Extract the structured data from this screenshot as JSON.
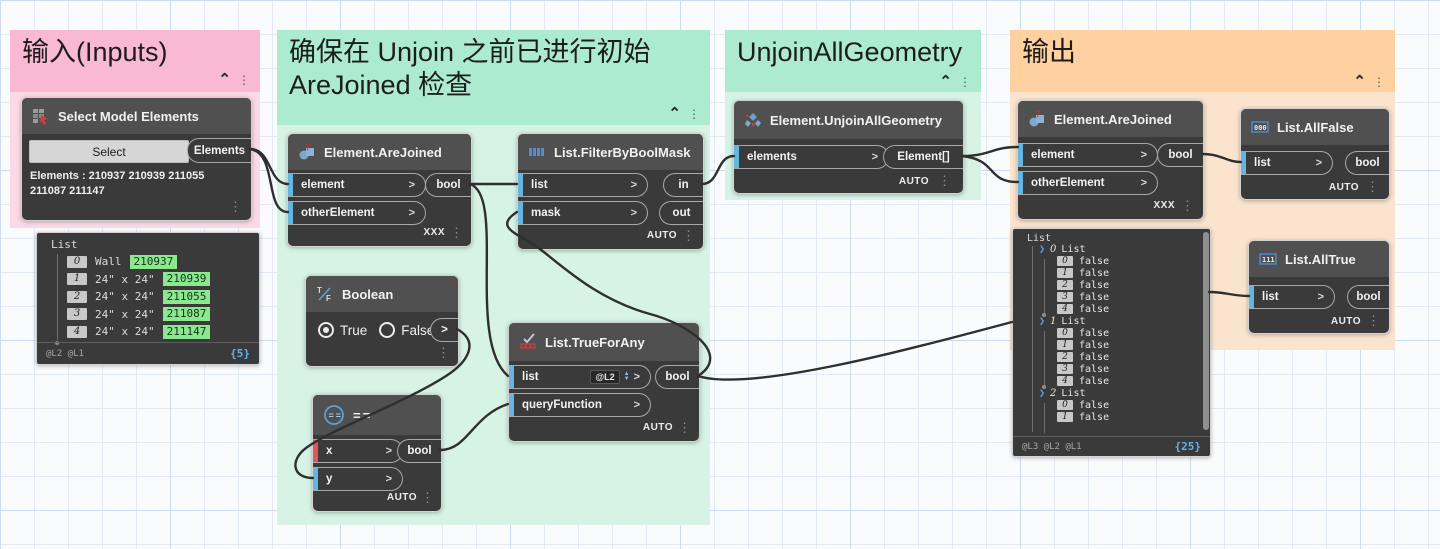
{
  "groups": {
    "inputs": {
      "title": "输入(Inputs)"
    },
    "check": {
      "title": "确保在 Unjoin 之前已进行初始 AreJoined 检查"
    },
    "unjoin": {
      "title": "UnjoinAllGeometry"
    },
    "outputs": {
      "title": "输出"
    }
  },
  "nodes": {
    "select_model_elements": {
      "title": "Select Model Elements",
      "button": "Select",
      "output": "Elements",
      "value_line1": "Elements : 210937 210939 211055",
      "value_line2": "211087 211147"
    },
    "watch_left": {
      "header": "List",
      "rows": [
        {
          "i": "0",
          "label": "Wall",
          "id": "210937"
        },
        {
          "i": "1",
          "label": "24\" x 24\"",
          "id": "210939"
        },
        {
          "i": "2",
          "label": "24\" x 24\"",
          "id": "211055"
        },
        {
          "i": "3",
          "label": "24\" x 24\"",
          "id": "211087"
        },
        {
          "i": "4",
          "label": "24\" x 24\"",
          "id": "211147"
        }
      ],
      "lacing": "@L2 @L1",
      "count": "{5}"
    },
    "are_joined_1": {
      "title": "Element.AreJoined",
      "port_element": "element",
      "port_other": "otherElement",
      "port_bool": "bool",
      "lacing": "XXX"
    },
    "filter": {
      "title": "List.FilterByBoolMask",
      "port_list": "list",
      "port_mask": "mask",
      "port_in": "in",
      "port_out": "out",
      "lacing": "AUTO"
    },
    "boolean": {
      "title": "Boolean",
      "opt_true": "True",
      "opt_false": "False",
      "selected": "True",
      "port_out": ">"
    },
    "equals": {
      "title": "==",
      "port_x": "x",
      "port_y": "y",
      "port_bool": "bool",
      "lacing": "AUTO",
      "x_connected": false,
      "y_connected": true
    },
    "true_for_any": {
      "title": "List.TrueForAny",
      "port_list": "list",
      "level_badge": "@L2",
      "port_query": "queryFunction",
      "port_bool": "bool",
      "lacing": "AUTO"
    },
    "unjoin_all": {
      "title": "Element.UnjoinAllGeometry",
      "port_elements": "elements",
      "port_out": "Element[]",
      "lacing": "AUTO"
    },
    "are_joined_2": {
      "title": "Element.AreJoined",
      "port_element": "element",
      "port_other": "otherElement",
      "port_bool": "bool",
      "lacing": "XXX"
    },
    "all_false": {
      "title": "List.AllFalse",
      "icon_text": "000",
      "port_list": "list",
      "port_bool": "bool",
      "lacing": "AUTO"
    },
    "all_true": {
      "title": "List.AllTrue",
      "icon_text": "111",
      "port_list": "list",
      "port_bool": "bool",
      "lacing": "AUTO"
    },
    "watch_big": {
      "header": "List",
      "sublists": [
        {
          "i": "0",
          "label": "List",
          "items": [
            "false",
            "false",
            "false",
            "false",
            "false"
          ]
        },
        {
          "i": "1",
          "label": "List",
          "items": [
            "false",
            "false",
            "false",
            "false",
            "false"
          ]
        },
        {
          "i": "2",
          "label": "List",
          "items": [
            "false",
            "false"
          ]
        }
      ],
      "lacing": "@L3 @L2 @L1",
      "count": "{25}"
    }
  },
  "colors": {
    "group_pink_title": "#F9B8D4",
    "group_pink_body": "#FBD9E7",
    "group_green_title": "#ACEBD0",
    "group_green_body": "#D7F3E6",
    "group_orange_title": "#FFD0A0",
    "group_orange_body": "#FAE4CE",
    "node_body": "#3A3A3A",
    "node_header": "#505050",
    "port_connected": "#64B5E0",
    "port_unconnected": "#E0555C",
    "id_badge_green": "#8BE88F",
    "count_blue": "#5FB2EE",
    "wire": "#2F2F2F"
  }
}
